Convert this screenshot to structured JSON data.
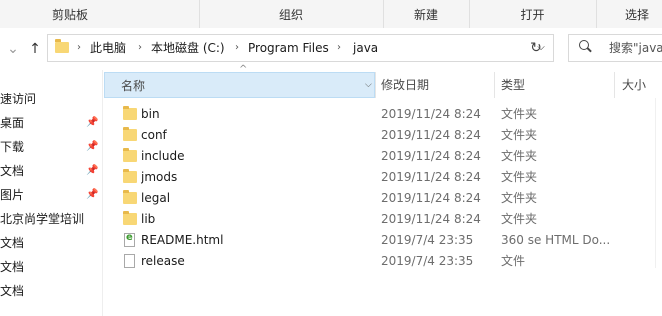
{
  "ribbon": {
    "groups": [
      "剪贴板",
      "组织",
      "新建",
      "打开",
      "选择"
    ]
  },
  "address_bar": {
    "crumbs": [
      "此电脑",
      "本地磁盘 (C:)",
      "Program Files",
      "java"
    ],
    "search_placeholder": "搜索\"java"
  },
  "sidebar": {
    "items": [
      {
        "label": "速访问",
        "pinned": false
      },
      {
        "label": "桌面",
        "pinned": true
      },
      {
        "label": "下载",
        "pinned": true
      },
      {
        "label": "文档",
        "pinned": true
      },
      {
        "label": "图片",
        "pinned": true
      },
      {
        "label": "北京尚学堂培训",
        "pinned": false
      },
      {
        "label": "文档",
        "pinned": false
      },
      {
        "label": "文档",
        "pinned": false
      },
      {
        "label": "文档",
        "pinned": false
      }
    ]
  },
  "columns": {
    "name": "名称",
    "date": "修改日期",
    "type": "类型",
    "size": "大小"
  },
  "files": [
    {
      "name": "bin",
      "date": "2019/11/24 8:24",
      "type": "文件夹",
      "icon": "folder"
    },
    {
      "name": "conf",
      "date": "2019/11/24 8:24",
      "type": "文件夹",
      "icon": "folder"
    },
    {
      "name": "include",
      "date": "2019/11/24 8:24",
      "type": "文件夹",
      "icon": "folder"
    },
    {
      "name": "jmods",
      "date": "2019/11/24 8:24",
      "type": "文件夹",
      "icon": "folder"
    },
    {
      "name": "legal",
      "date": "2019/11/24 8:24",
      "type": "文件夹",
      "icon": "folder"
    },
    {
      "name": "lib",
      "date": "2019/11/24 8:24",
      "type": "文件夹",
      "icon": "folder"
    },
    {
      "name": "README.html",
      "date": "2019/7/4 23:35",
      "type": "360 se HTML Do...",
      "icon": "html"
    },
    {
      "name": "release",
      "date": "2019/7/4 23:35",
      "type": "文件",
      "icon": "file"
    }
  ],
  "colors": {
    "folder": "#f8d775",
    "sorted_header": "#d9ebf9"
  }
}
